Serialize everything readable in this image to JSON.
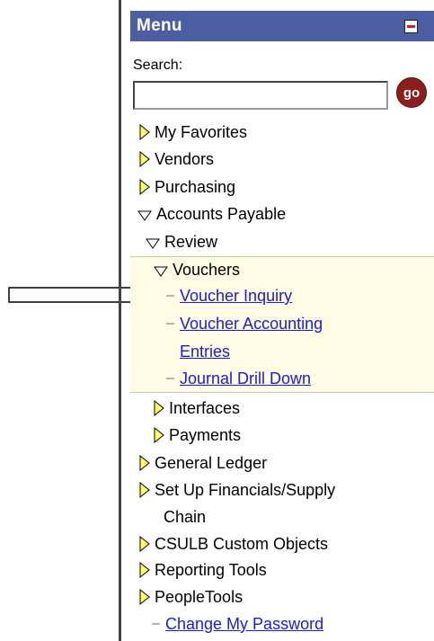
{
  "menu": {
    "title": "Menu",
    "search_label": "Search:",
    "search_value": "",
    "go_label": "go",
    "items": [
      {
        "label": "My Favorites",
        "type": "folder",
        "state": "collapsed",
        "level": 0
      },
      {
        "label": "Vendors",
        "type": "folder",
        "state": "collapsed",
        "level": 0
      },
      {
        "label": "Purchasing",
        "type": "folder",
        "state": "collapsed",
        "level": 0
      },
      {
        "label": "Accounts Payable",
        "type": "folder",
        "state": "expanded",
        "level": 0
      },
      {
        "label": "Review",
        "type": "folder",
        "state": "expanded",
        "level": 1
      },
      {
        "label": "Vouchers",
        "type": "folder",
        "state": "expanded",
        "level": 2
      },
      {
        "label": "Voucher Inquiry",
        "type": "link",
        "level": 3
      },
      {
        "label": "Voucher Accounting",
        "type": "link",
        "level": 3
      },
      {
        "label": "Entries",
        "type": "link",
        "level": 3
      },
      {
        "label": "Journal Drill Down",
        "type": "link",
        "level": 3
      },
      {
        "label": "Interfaces",
        "type": "folder",
        "state": "collapsed",
        "level": 1
      },
      {
        "label": "Payments",
        "type": "folder",
        "state": "collapsed",
        "level": 1
      },
      {
        "label": "General Ledger",
        "type": "folder",
        "state": "collapsed",
        "level": 0
      },
      {
        "label": "Set Up Financials/Supply",
        "type": "folder",
        "state": "collapsed",
        "level": 0
      },
      {
        "label": "Chain",
        "type": "folder",
        "level": 0
      },
      {
        "label": "CSULB Custom Objects",
        "type": "folder",
        "state": "collapsed",
        "level": 0
      },
      {
        "label": "Reporting Tools",
        "type": "folder",
        "state": "collapsed",
        "level": 0
      },
      {
        "label": "PeopleTools",
        "type": "folder",
        "state": "collapsed",
        "level": 0
      },
      {
        "label": "Change My Password",
        "type": "link",
        "level": 0
      }
    ]
  },
  "colors": {
    "header_bg": "#4b5ea2",
    "highlight_bg": "#fffbe5",
    "link": "#1b1bd6",
    "triangle_fill": "#ffff66",
    "go_button": "#8c1e1e"
  }
}
